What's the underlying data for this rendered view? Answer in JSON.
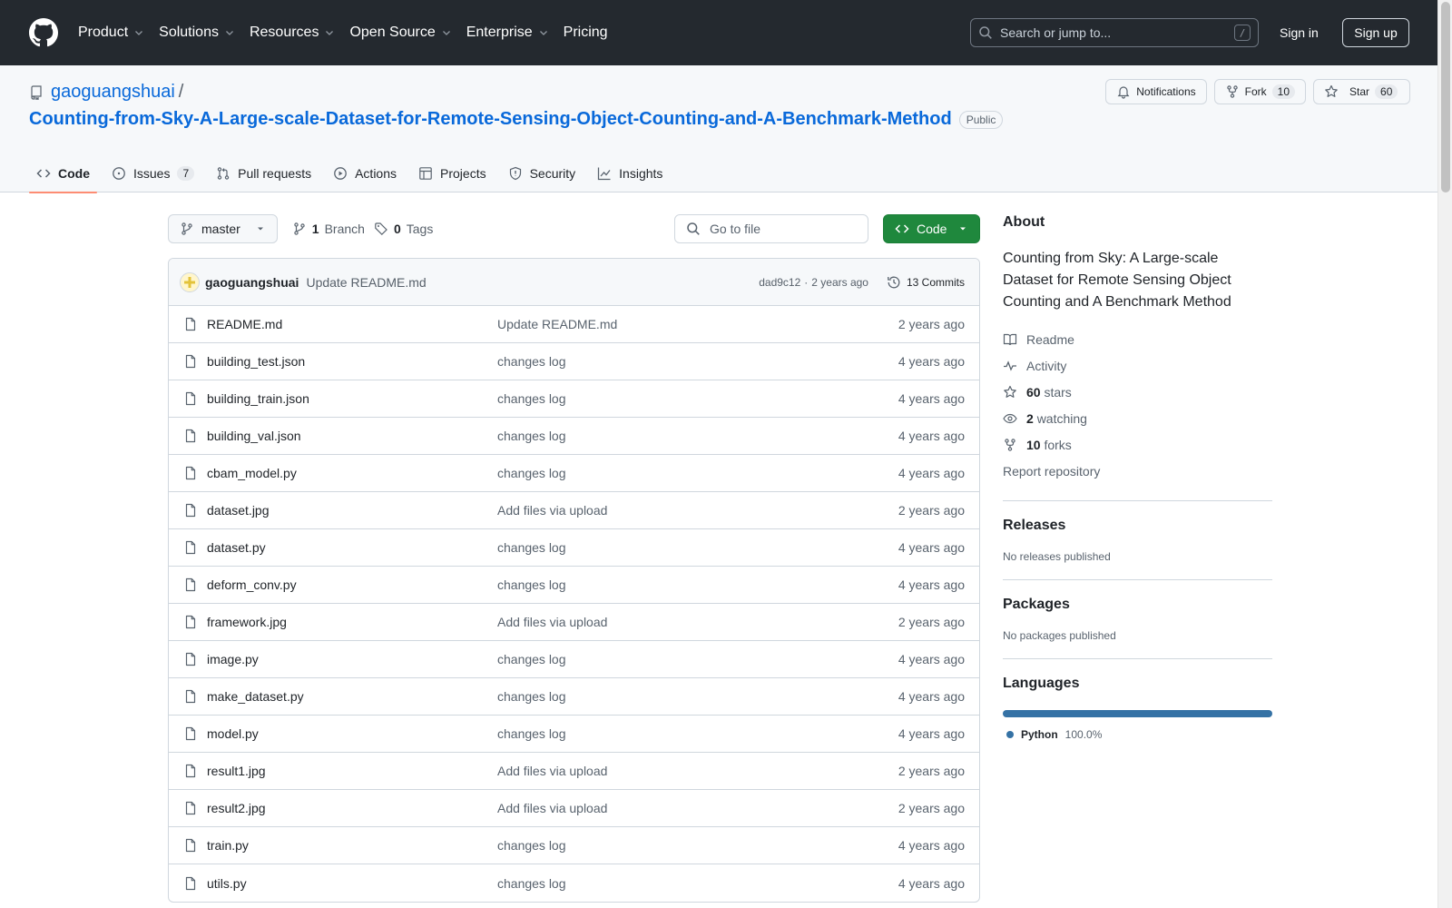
{
  "header": {
    "nav": [
      "Product",
      "Solutions",
      "Resources",
      "Open Source",
      "Enterprise",
      "Pricing"
    ],
    "search_placeholder": "Search or jump to...",
    "search_shortcut": "/",
    "sign_in": "Sign in",
    "sign_up": "Sign up"
  },
  "repo": {
    "owner": "gaoguangshuai",
    "separator": "/",
    "name": "Counting-from-Sky-A-Large-scale-Dataset-for-Remote-Sensing-Object-Counting-and-A-Benchmark-Method",
    "visibility": "Public",
    "notifications_label": "Notifications",
    "fork_label": "Fork",
    "fork_count": "10",
    "star_label": "Star",
    "star_count": "60"
  },
  "tabs": [
    {
      "label": "Code",
      "icon": "code-icon",
      "selected": true
    },
    {
      "label": "Issues",
      "icon": "issue-icon",
      "count": "7"
    },
    {
      "label": "Pull requests",
      "icon": "pull-request-icon"
    },
    {
      "label": "Actions",
      "icon": "play-icon"
    },
    {
      "label": "Projects",
      "icon": "table-icon"
    },
    {
      "label": "Security",
      "icon": "shield-icon"
    },
    {
      "label": "Insights",
      "icon": "graph-icon"
    }
  ],
  "toolbar": {
    "branch": "master",
    "branch_count": "1",
    "branch_label": "Branch",
    "tag_count": "0",
    "tag_label": "Tags",
    "goto_placeholder": "Go to file",
    "code_button": "Code"
  },
  "latest_commit": {
    "author": "gaoguangshuai",
    "message": "Update README.md",
    "sha": "dad9c12",
    "separator": "·",
    "age": "2 years ago",
    "commits_label": "13 Commits"
  },
  "files": [
    {
      "name": "README.md",
      "commit": "Update README.md",
      "age": "2 years ago"
    },
    {
      "name": "building_test.json",
      "commit": "changes log",
      "age": "4 years ago"
    },
    {
      "name": "building_train.json",
      "commit": "changes log",
      "age": "4 years ago"
    },
    {
      "name": "building_val.json",
      "commit": "changes log",
      "age": "4 years ago"
    },
    {
      "name": "cbam_model.py",
      "commit": "changes log",
      "age": "4 years ago"
    },
    {
      "name": "dataset.jpg",
      "commit": "Add files via upload",
      "age": "2 years ago"
    },
    {
      "name": "dataset.py",
      "commit": "changes log",
      "age": "4 years ago"
    },
    {
      "name": "deform_conv.py",
      "commit": "changes log",
      "age": "4 years ago"
    },
    {
      "name": "framework.jpg",
      "commit": "Add files via upload",
      "age": "2 years ago"
    },
    {
      "name": "image.py",
      "commit": "changes log",
      "age": "4 years ago"
    },
    {
      "name": "make_dataset.py",
      "commit": "changes log",
      "age": "4 years ago"
    },
    {
      "name": "model.py",
      "commit": "changes log",
      "age": "4 years ago"
    },
    {
      "name": "result1.jpg",
      "commit": "Add files via upload",
      "age": "2 years ago"
    },
    {
      "name": "result2.jpg",
      "commit": "Add files via upload",
      "age": "2 years ago"
    },
    {
      "name": "train.py",
      "commit": "changes log",
      "age": "4 years ago"
    },
    {
      "name": "utils.py",
      "commit": "changes log",
      "age": "4 years ago"
    }
  ],
  "about": {
    "title": "About",
    "description": "Counting from Sky: A Large-scale Dataset for Remote Sensing Object Counting and A Benchmark Method",
    "readme": "Readme",
    "activity": "Activity",
    "stars_count": "60",
    "stars_label": "stars",
    "watching_count": "2",
    "watching_label": "watching",
    "forks_count": "10",
    "forks_label": "forks",
    "report": "Report repository"
  },
  "releases": {
    "title": "Releases",
    "note": "No releases published"
  },
  "packages": {
    "title": "Packages",
    "note": "No packages published"
  },
  "languages": {
    "title": "Languages",
    "items": [
      {
        "name": "Python",
        "percent": "100.0%",
        "color": "#3572a5"
      }
    ]
  },
  "colors": {
    "header_bg": "#24292f",
    "link": "#0969da",
    "code_button": "#1f883d",
    "tab_underline": "#fd8c73",
    "python": "#3572a5"
  }
}
